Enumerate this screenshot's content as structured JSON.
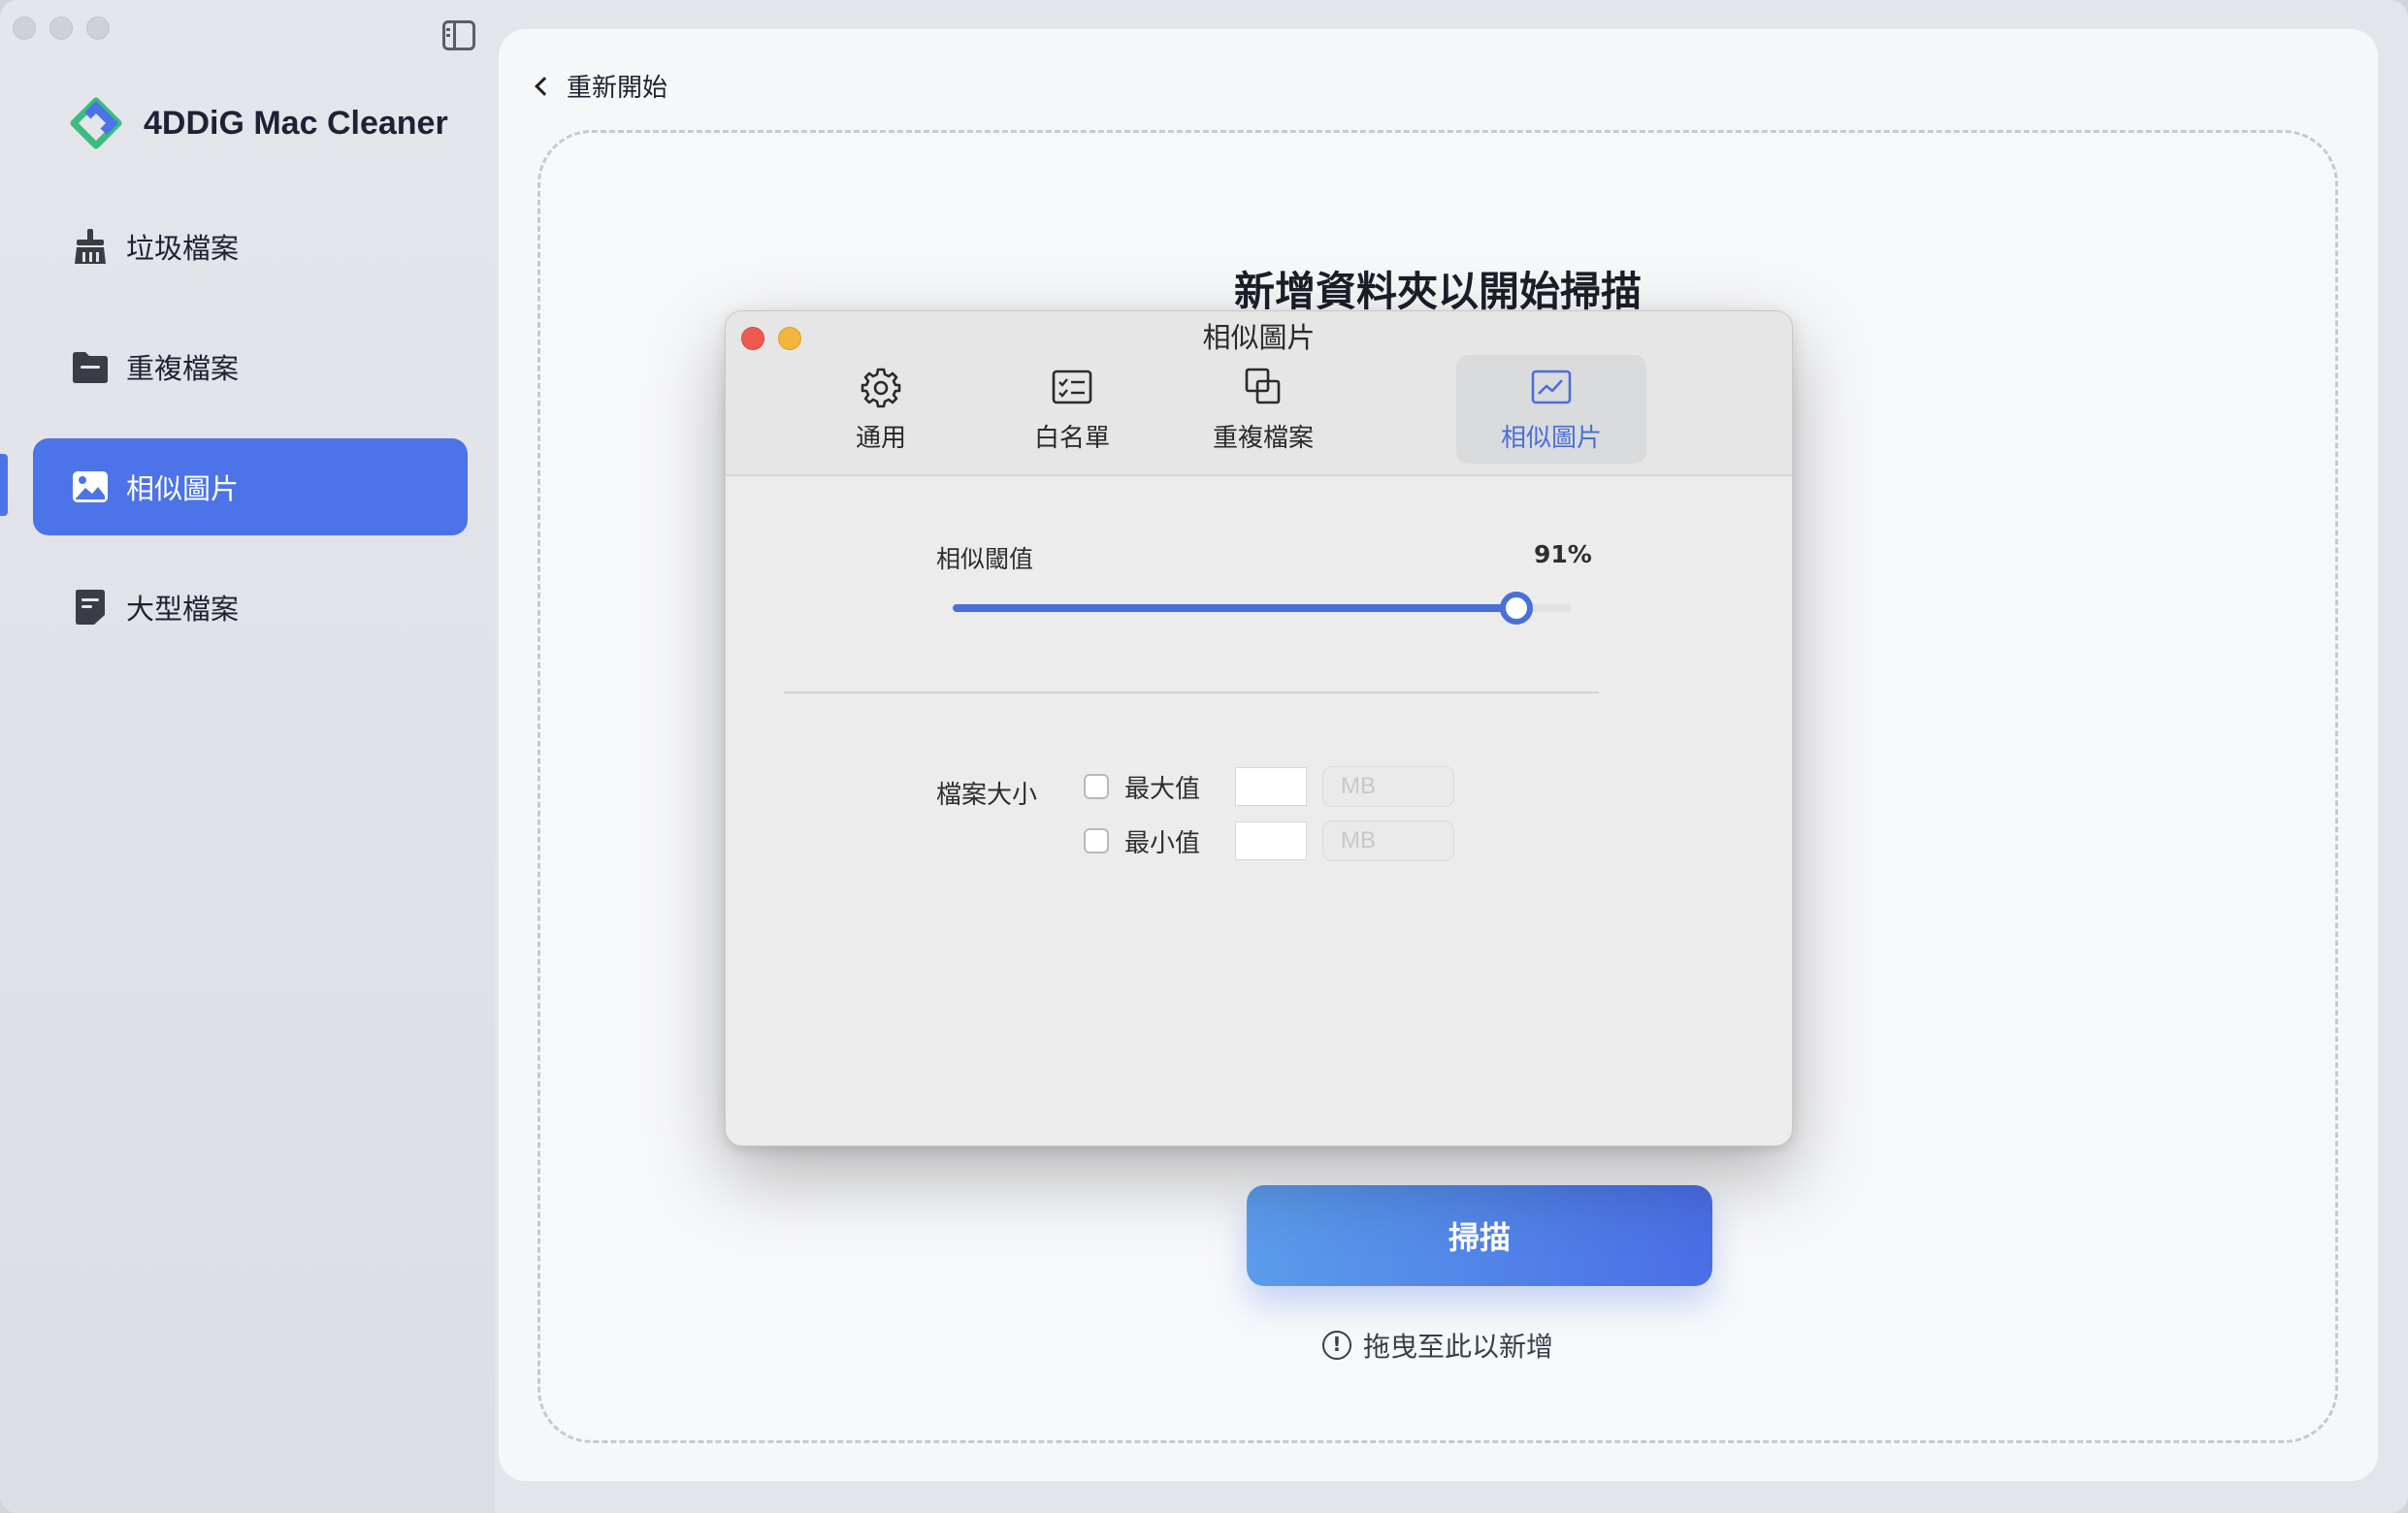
{
  "app": {
    "name": "4DDiG Mac Cleaner"
  },
  "sidebar": {
    "items": [
      {
        "label": "垃圾檔案",
        "icon": "broom-icon"
      },
      {
        "label": "重複檔案",
        "icon": "folder-icon"
      },
      {
        "label": "相似圖片",
        "icon": "image-icon",
        "active": true
      },
      {
        "label": "大型檔案",
        "icon": "large-file-icon"
      }
    ]
  },
  "header": {
    "back_label": "重新開始"
  },
  "main": {
    "title": "新增資料夾以開始掃描",
    "scan_button": "掃描",
    "drop_hint": "拖曳至此以新增",
    "hint_icon": "!"
  },
  "dialog": {
    "title": "相似圖片",
    "tabs": [
      {
        "label": "通用",
        "icon": "gear-icon"
      },
      {
        "label": "白名單",
        "icon": "checklist-icon"
      },
      {
        "label": "重複檔案",
        "icon": "duplicate-icon"
      },
      {
        "label": "相似圖片",
        "icon": "image-chart-icon",
        "active": true
      }
    ],
    "threshold": {
      "label": "相似閾值",
      "value_text": "91%",
      "value_fraction": 0.91
    },
    "file_size": {
      "label": "檔案大小",
      "max": {
        "label": "最大值",
        "value": "",
        "unit": "MB",
        "checked": false
      },
      "min": {
        "label": "最小值",
        "value": "",
        "unit": "MB",
        "checked": false
      }
    }
  },
  "colors": {
    "accent": "#4c73e8",
    "close": "#ee5a52",
    "minimize": "#f3b53b"
  }
}
